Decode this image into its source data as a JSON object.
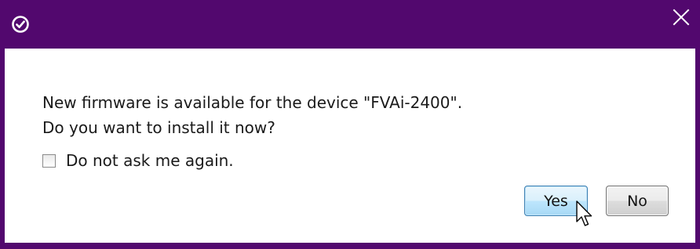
{
  "dialog": {
    "message_line1": "New firmware is available for the device \"FVAi-2400\".",
    "message_line2": "Do you want to install it now?",
    "checkbox_label": "Do not ask me again.",
    "checkbox_checked": false,
    "yes_label": "Yes",
    "no_label": "No"
  },
  "icons": {
    "app": "checkmark-circle-icon",
    "close": "close-icon",
    "cursor": "mouse-pointer-icon"
  },
  "colors": {
    "titlebar": "#52086e",
    "yes_border": "#3c7fb1"
  }
}
